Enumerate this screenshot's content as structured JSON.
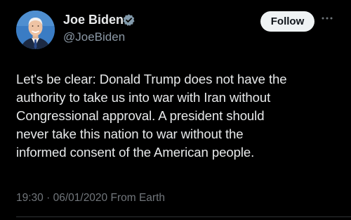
{
  "author": {
    "name": "Joe Biden",
    "handle": "@JoeBiden",
    "verified_icon": "verified-badge-icon",
    "avatar_icon": "profile-photo"
  },
  "actions": {
    "follow_label": "Follow",
    "more_icon": "more-options-icon"
  },
  "tweet": {
    "lines": [
      "Let's be clear: Donald Trump does not have the",
      "authority to take us into war with Iran without",
      "Congressional approval. A president should",
      "never take this nation to war without the",
      "informed consent of the American people."
    ],
    "time": "19:30",
    "separator": "·",
    "date": "06/01/2020",
    "source": "From Earth"
  },
  "colors": {
    "background": "#000000",
    "text": "#e7e9ea",
    "secondary": "#71767b",
    "verified": "#829aab",
    "follow_bg": "#eff3f4"
  }
}
